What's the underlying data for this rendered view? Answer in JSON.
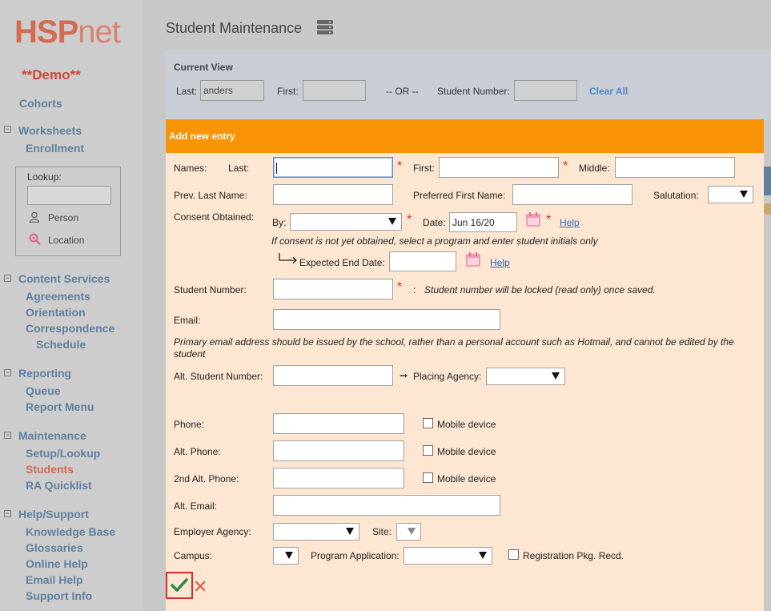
{
  "logo": {
    "hsp": "HSP",
    "net": "net"
  },
  "sidebar": {
    "demo": "**Demo**",
    "cohorts": "Cohorts",
    "worksheets": {
      "title": "Worksheets",
      "items": [
        "Enrollment"
      ]
    },
    "lookup": {
      "title": "Lookup:",
      "person": "Person",
      "location": "Location"
    },
    "content_services": {
      "title": "Content Services",
      "items": [
        "Agreements",
        "Orientation",
        "Correspondence",
        "Schedule"
      ]
    },
    "reporting": {
      "title": "Reporting",
      "items": [
        "Queue",
        "Report Menu"
      ]
    },
    "maintenance": {
      "title": "Maintenance",
      "items": [
        "Setup/Lookup",
        "Students",
        "RA Quicklist"
      ]
    },
    "help": {
      "title": "Help/Support",
      "items": [
        "Knowledge Base",
        "Glossaries",
        "Online Help",
        "Email Help",
        "Support Info"
      ]
    },
    "toggle_symbol": "⊟"
  },
  "header": {
    "title": "Student Maintenance"
  },
  "current_view": {
    "title": "Current View",
    "last_label": "Last:",
    "last_value": "anders",
    "first_label": "First:",
    "first_value": "",
    "or_label": "-- OR --",
    "student_number_label": "Student Number:",
    "student_number_value": "",
    "clear_all": "Clear All"
  },
  "entry": {
    "header": "Add new entry",
    "names_label": "Names:",
    "last_label": "Last:",
    "first_label": "First:",
    "middle_label": "Middle:",
    "prev_last_label": "Prev. Last Name:",
    "preferred_first_label": "Preferred First Name:",
    "salutation_label": "Salutation:",
    "consent_label": "Consent Obtained:",
    "by_label": "By:",
    "date_label": "Date:",
    "date_value": "Jun 16/20",
    "help": "Help",
    "consent_note": "If consent is not yet obtained, select a program and enter student initials only",
    "expected_end_label": "Expected End Date:",
    "student_number_label": "Student Number:",
    "colon": ":",
    "student_number_note": "Student number will be locked (read only) once saved.",
    "email_label": "Email:",
    "email_note": "Primary email address should be issued by the school, rather than a personal account such as Hotmail, and cannot be edited by the student",
    "alt_student_number_label": "Alt. Student Number:",
    "arrow": "➞",
    "placing_agency_label": "Placing Agency:",
    "phone_label": "Phone:",
    "alt_phone_label": "Alt. Phone:",
    "alt2_phone_label": "2nd Alt. Phone:",
    "mobile_device": "Mobile device",
    "alt_email_label": "Alt. Email:",
    "employer_label": "Employer Agency:",
    "site_label": "Site:",
    "campus_label": "Campus:",
    "program_app_label": "Program Application:",
    "registration_label": "Registration Pkg. Recd.",
    "required_mark": "*",
    "cancel_symbol": "✕"
  },
  "colors": {
    "accent_orange": "#fa9407",
    "panel_bg": "#fde7d2",
    "link_blue": "#4d87c6",
    "required_red": "#d92c2c"
  }
}
